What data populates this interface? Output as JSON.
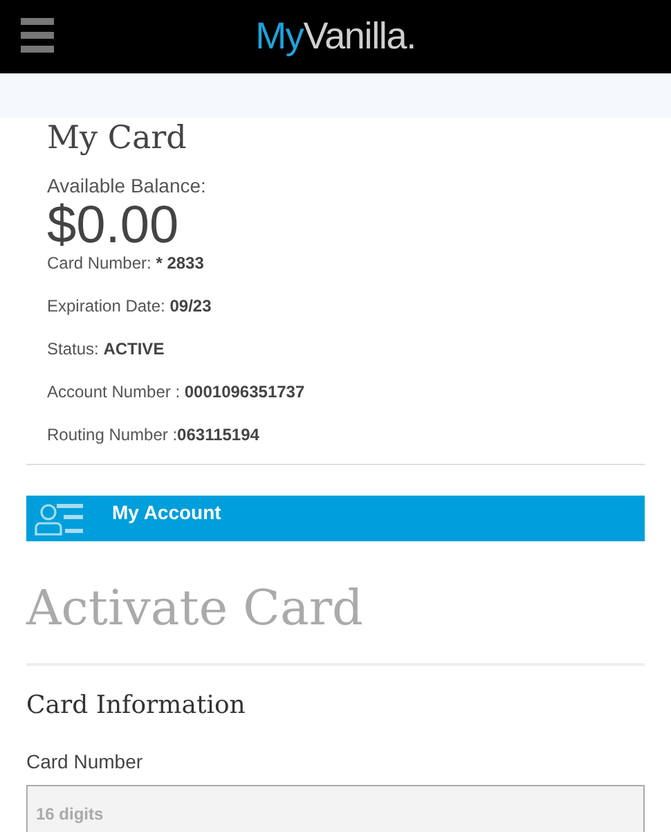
{
  "header": {
    "logo": [
      "My",
      "Vanilla."
    ]
  },
  "card": {
    "title": "My Card",
    "balance_label": "Available Balance:",
    "balance": "$0.00",
    "details": [
      {
        "label": "Card Number: ",
        "value": "* 2833"
      },
      {
        "label": "Expiration Date: ",
        "value": "09/23"
      },
      {
        "label": "Status: ",
        "value": "ACTIVE"
      },
      {
        "label": "Account Number : ",
        "value": "0001096351737"
      },
      {
        "label": "Routing Number :",
        "value": "063115194"
      }
    ]
  },
  "account_bar": {
    "label": "My Account"
  },
  "activate": {
    "title": "Activate Card",
    "section": "Card Information",
    "field_label": "Card Number",
    "placeholder": "16 digits"
  }
}
